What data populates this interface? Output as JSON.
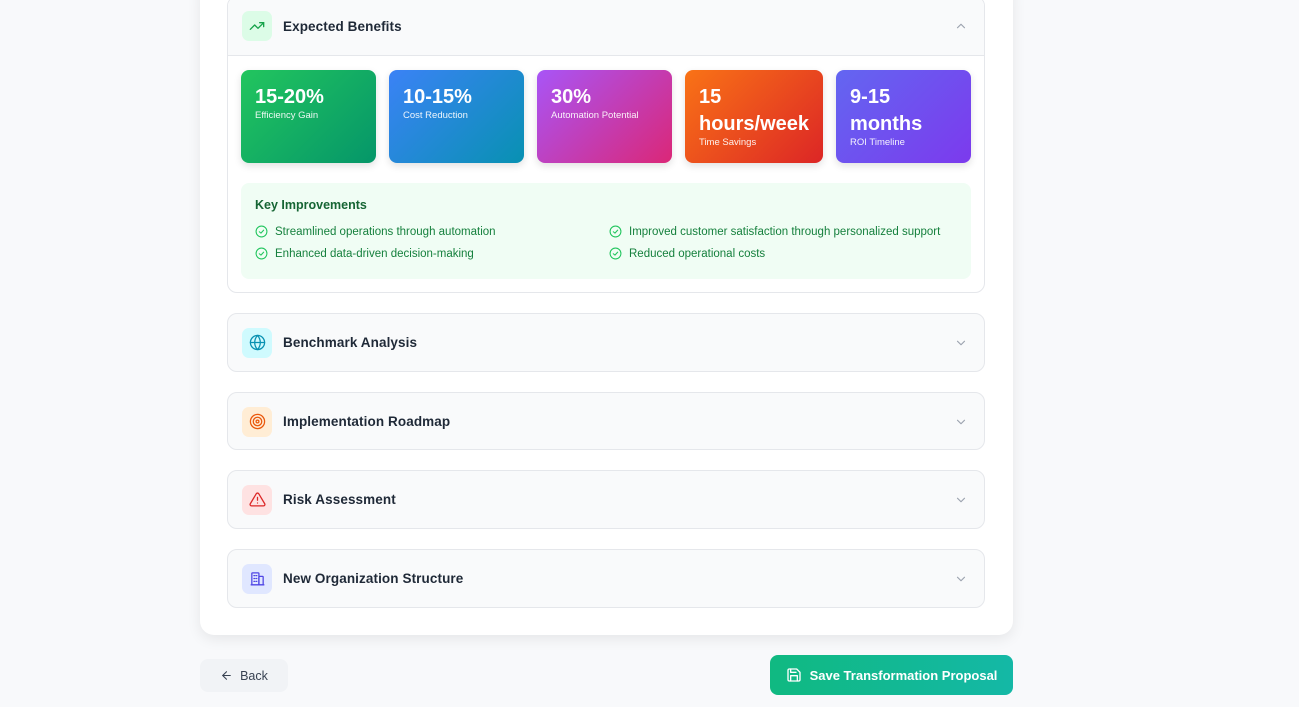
{
  "sections": {
    "benefits": {
      "title": "Expected Benefits",
      "icon": "trending-up-icon",
      "expanded": true
    },
    "benchmark": {
      "title": "Benchmark Analysis",
      "icon": "globe-icon",
      "expanded": false
    },
    "roadmap": {
      "title": "Implementation Roadmap",
      "icon": "target-icon",
      "expanded": false
    },
    "risk": {
      "title": "Risk Assessment",
      "icon": "alert-triangle-icon",
      "expanded": false
    },
    "org": {
      "title": "New Organization Structure",
      "icon": "building-icon",
      "expanded": false
    }
  },
  "metrics": [
    {
      "value": "15-20%",
      "label": "Efficiency Gain"
    },
    {
      "value": "10-15%",
      "label": "Cost Reduction"
    },
    {
      "value": "30%",
      "label": "Automation Potential"
    },
    {
      "value": "15 hours/week",
      "label": "Time Savings"
    },
    {
      "value": "9-15 months",
      "label": "ROI Timeline"
    }
  ],
  "improvements": {
    "title": "Key Improvements",
    "items": [
      "Streamlined operations through automation",
      "Improved customer satisfaction through personalized support",
      "Enhanced data-driven decision-making",
      "Reduced operational costs"
    ]
  },
  "actions": {
    "back_label": "Back",
    "save_label": "Save Transformation Proposal"
  },
  "colors": {
    "accent": "#10b981",
    "improve_bg": "#f0fdf4",
    "improve_text": "#15803d"
  }
}
